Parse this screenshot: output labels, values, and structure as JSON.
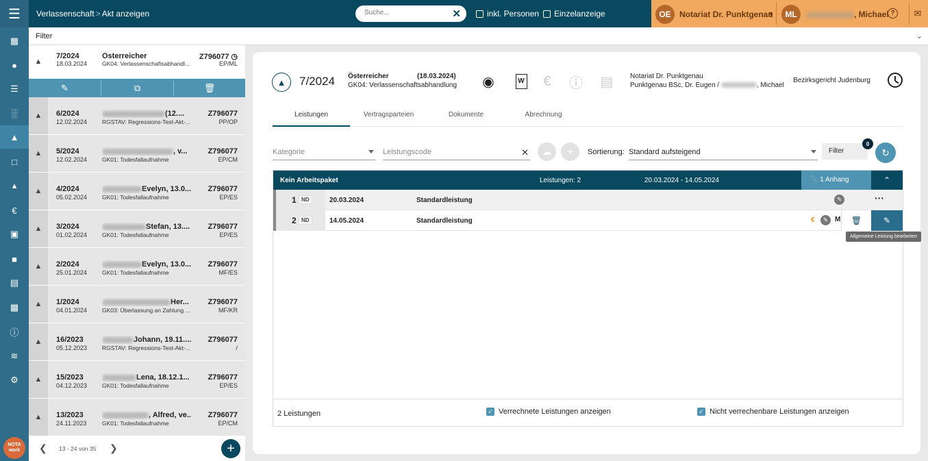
{
  "topbar": {
    "breadcrumb_1": "Verlassenschaft",
    "breadcrumb_sep": ">",
    "breadcrumb_2": "Akt anzeigen",
    "search_placeholder": "Suche...",
    "check_personen": "inkl. Personen",
    "check_einzel": "Einzelanzeige",
    "org_initials": "OE",
    "org_name": "Notariat Dr. Punktgenau",
    "user_initials": "ML",
    "user_name": ", Michael",
    "help_icon": "question-circle-icon",
    "mail_icon": "mail-icon"
  },
  "filterbar": {
    "label": "Filter"
  },
  "akten": [
    {
      "num": "7/2024",
      "date": "18.03.2024",
      "name": "Österreicher",
      "gk": "GK04: Verlassenschaftsabhandl...",
      "z": "Z796077",
      "ini": "EP/ML"
    },
    {
      "num": "6/2024",
      "date": "12.02.2024",
      "name": "(12....",
      "gk": "RGSTAV: Regressions-Test-Akt-...",
      "z": "Z796077",
      "ini": "PP/OP"
    },
    {
      "num": "5/2024",
      "date": "12.02.2024",
      "name": ", v...",
      "gk": "GK01: Todesfallaufnahme",
      "z": "Z796077",
      "ini": "EP/CM"
    },
    {
      "num": "4/2024",
      "date": "05.02.2024",
      "name": "Evelyn, 13.0...",
      "gk": "GK01: Todesfallaufnahme",
      "z": "Z796077",
      "ini": "EP/ES"
    },
    {
      "num": "3/2024",
      "date": "01.02.2024",
      "name": "Stefan, 13....",
      "gk": "GK01: Todesfallaufnahme",
      "z": "Z796077",
      "ini": "EP/ES"
    },
    {
      "num": "2/2024",
      "date": "25.01.2024",
      "name": "Evelyn, 13.0...",
      "gk": "GK01: Todesfallaufnahme",
      "z": "Z796077",
      "ini": "MF/ES"
    },
    {
      "num": "1/2024",
      "date": "04.01.2024",
      "name": "Her...",
      "gk": "GK03: Überlassung an Zahlung ...",
      "z": "Z796077",
      "ini": "MF/KR"
    },
    {
      "num": "16/2023",
      "date": "05.12.2023",
      "name": "Johann, 19.11....",
      "gk": "RGSTAV: Regressions-Test-Akt-...",
      "z": "Z796077",
      "ini": "/"
    },
    {
      "num": "15/2023",
      "date": "04.12.2023",
      "name": "Lena, 18.12.1...",
      "gk": "GK01: Todesfallaufnahme",
      "z": "Z796077",
      "ini": "EP/ES"
    },
    {
      "num": "13/2023",
      "date": "24.11.2023",
      "name": ", Alfred, ve...",
      "gk": "GK01: Todesfallaufnahme",
      "z": "Z796077",
      "ini": "EP/CM"
    }
  ],
  "pager": {
    "label": "13 - 24 von 35"
  },
  "header": {
    "num": "7/2024",
    "name": "Österreicher",
    "datum": "(18.03.2024)",
    "gk": "GK04: Verlassenschaftsabhandlung",
    "notar_1": "Notariat Dr. Punktgenau",
    "notar_2a": "Punktgenau BSc, Dr. Eugen /",
    "notar_2b": ", Michael",
    "gericht": "Bezirksgericht Judenburg"
  },
  "tabs": [
    "Leistungen",
    "Vertragsparteien",
    "Dokumente",
    "Abrechnung"
  ],
  "filters": {
    "kategorie": "Kategorie",
    "leistungscode": "Leistungscode",
    "sort_label": "Sortierung:",
    "sort_value": "Standard aufsteigend",
    "filter_btn": "Filter",
    "filter_badge": "0"
  },
  "table": {
    "group": "Kein Arbeitspaket",
    "count_label": "Leistungen: 2",
    "range": "20.03.2024 - 14.05.2024",
    "anhang": "1 Anhang",
    "rows": [
      {
        "nr": "1",
        "badge": "ND",
        "date": "20.03.2024",
        "art": "Standardleistung"
      },
      {
        "nr": "2",
        "badge": "ND",
        "date": "14.05.2024",
        "art": "Standardleistung",
        "flag_eur": "€",
        "flag_m": "M"
      }
    ],
    "tooltip": "Allgemeine Leistung bearbeiten",
    "footer_count": "2 Leistungen",
    "footer_chk_1": "Verrechnete Leistungen anzeigen",
    "footer_chk_2": "Nicht verrechenbare Leistungen anzeigen"
  },
  "colors": {
    "primary": "#09495f",
    "accent": "#4f94b3",
    "org": "#f0a95e",
    "nav": "#2f6d8a"
  }
}
